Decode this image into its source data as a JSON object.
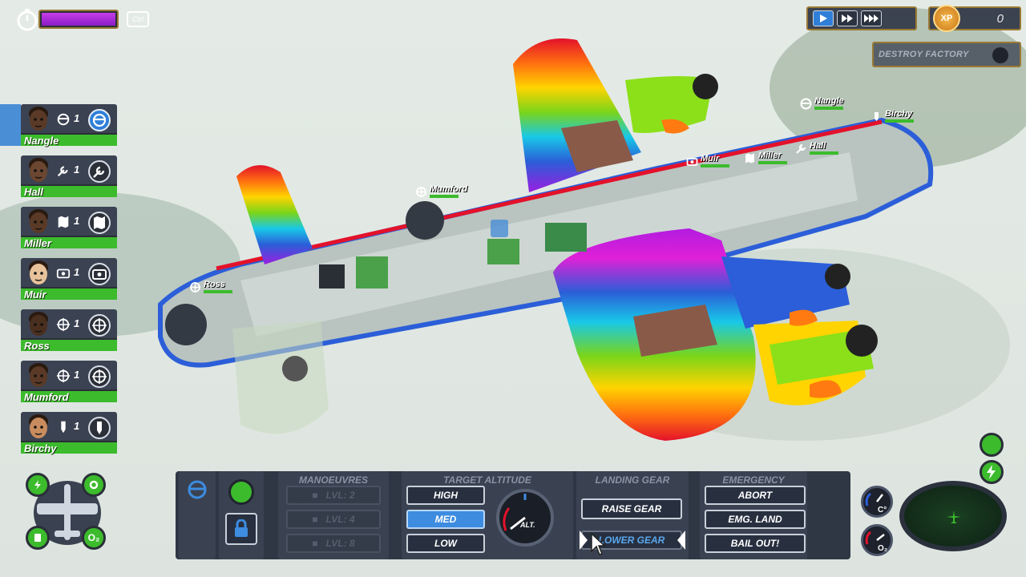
{
  "hud": {
    "ctrl_key": "Ctrl",
    "boost_fraction": 1.0,
    "xp_badge": "XP",
    "xp_value": "0",
    "mission": "DESTROY FACTORY"
  },
  "crew": [
    {
      "name": "Nangle",
      "level": "1",
      "role_icon": "steering-wheel-icon"
    },
    {
      "name": "Hall",
      "level": "1",
      "role_icon": "wrench-icon"
    },
    {
      "name": "Miller",
      "level": "1",
      "role_icon": "map-icon"
    },
    {
      "name": "Muir",
      "level": "1",
      "role_icon": "camera-icon"
    },
    {
      "name": "Ross",
      "level": "1",
      "role_icon": "crosshair-icon"
    },
    {
      "name": "Mumford",
      "level": "1",
      "role_icon": "crosshair-icon"
    },
    {
      "name": "Birchy",
      "level": "1",
      "role_icon": "bomb-icon"
    }
  ],
  "plane_tags": {
    "nangle": "Nangle",
    "birchy": "Birchy",
    "hall": "Hall",
    "miller": "Miller",
    "muir": "Muir",
    "mumford": "Mumford",
    "ross": "Ross"
  },
  "panel": {
    "manoeuvres": {
      "title": "MANOEUVRES",
      "items": [
        "LVL: 2",
        "LVL: 4",
        "LVL: 8"
      ]
    },
    "altitude": {
      "title": "TARGET ALTITUDE",
      "options": [
        "HIGH",
        "MED",
        "LOW"
      ],
      "selected": "MED",
      "gauge_label": "ALT."
    },
    "landing_gear": {
      "title": "LANDING GEAR",
      "raise": "RAISE GEAR",
      "lower": "LOWER GEAR"
    },
    "emergency": {
      "title": "EMERGENCY",
      "abort": "ABORT",
      "emg_land": "EMG. LAND",
      "bail_out": "BAIL OUT!"
    }
  },
  "gauges": {
    "temp_label": "C°",
    "oxygen_label": "O₂",
    "overview_oxygen": "O₂"
  },
  "colors": {
    "health_green": "#3cbb2c",
    "accent_blue": "#3d8ce0",
    "frame_gold": "#9a7a35",
    "boost_purple": "#b02de0"
  }
}
